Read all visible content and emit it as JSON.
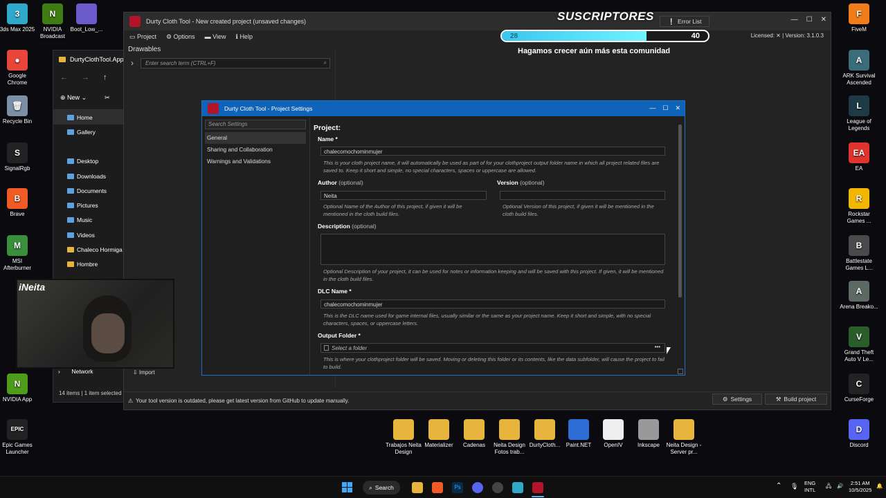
{
  "desktop": {
    "left_icons": [
      {
        "label": "3ds Max 2025",
        "icon": "3dsmax-icon",
        "color": "#2fa9c9",
        "glyph": "3"
      },
      {
        "label": "Google Chrome",
        "icon": "chrome-icon",
        "color": "#e8463a",
        "glyph": "●"
      },
      {
        "label": "Recycle Bin",
        "icon": "recycle-bin-icon",
        "color": "#7b8fa5",
        "glyph": "🗑"
      },
      {
        "label": "SignalRgb",
        "icon": "signalrgb-icon",
        "color": "#222",
        "glyph": "S"
      },
      {
        "label": "Brave",
        "icon": "brave-icon",
        "color": "#f05a24",
        "glyph": "B"
      },
      {
        "label": "MSI Afterburner",
        "icon": "msi-afterburner-icon",
        "color": "#3a8f3a",
        "glyph": "M"
      },
      {
        "label": "NVIDIA App",
        "icon": "nvidia-icon",
        "color": "#4f9b1a",
        "glyph": "N"
      },
      {
        "label": "Epic Games Launcher",
        "icon": "epic-games-icon",
        "color": "#222",
        "glyph": "EPIC"
      }
    ],
    "top_icons": [
      {
        "label": "NVIDIA Broadcast",
        "icon": "nvidia-broadcast-icon",
        "color": "#3e7d12",
        "glyph": "N"
      },
      {
        "label": "Boot_Low_...",
        "icon": "image-file-icon",
        "color": "#6b5bc8",
        "glyph": ""
      }
    ],
    "right_icons": [
      {
        "label": "FiveM",
        "icon": "fivem-icon",
        "color": "#f07d19",
        "glyph": "F"
      },
      {
        "label": "ARK Survival Ascended",
        "icon": "ark-icon",
        "color": "#3a6c7a",
        "glyph": "A"
      },
      {
        "label": "League of Legends",
        "icon": "lol-icon",
        "color": "#1d3a45",
        "glyph": "L"
      },
      {
        "label": "EA",
        "icon": "ea-icon",
        "color": "#e1342c",
        "glyph": "EA"
      },
      {
        "label": "Rockstar Games ...",
        "icon": "rockstar-icon",
        "color": "#f2b705",
        "glyph": "R"
      },
      {
        "label": "Battlestate Games L...",
        "icon": "battlestate-icon",
        "color": "#4a4a4a",
        "glyph": "B"
      },
      {
        "label": "Arena Breako...",
        "icon": "arena-breakout-icon",
        "color": "#5d6a64",
        "glyph": "A"
      },
      {
        "label": "Grand Theft Auto V Le...",
        "icon": "gta-icon",
        "color": "#2b5d2b",
        "glyph": "V"
      },
      {
        "label": "CurseForge",
        "icon": "curseforge-icon",
        "color": "#222",
        "glyph": "C"
      },
      {
        "label": "Discord",
        "icon": "discord-icon",
        "color": "#5865f2",
        "glyph": "D"
      }
    ],
    "bottom_icons": [
      {
        "label": "Trabajos Neita Design",
        "icon": "folder-icon"
      },
      {
        "label": "Materializer",
        "icon": "folder-icon"
      },
      {
        "label": "Cadenas",
        "icon": "folder-icon"
      },
      {
        "label": "Neita Design Fotos trab...",
        "icon": "folder-icon"
      },
      {
        "label": "DurtyCloth...",
        "icon": "folder-icon"
      },
      {
        "label": "Paint.NET",
        "icon": "paintnet-icon"
      },
      {
        "label": "OpenIV",
        "icon": "openiv-icon"
      },
      {
        "label": "Inkscape",
        "icon": "inkscape-icon"
      },
      {
        "label": "Neita Design - Server pr...",
        "icon": "folder-icon"
      }
    ]
  },
  "explorer": {
    "title": "DurtyClothTool.App",
    "new_label": "New",
    "nav_items": [
      {
        "label": "Home",
        "icon": "home-icon",
        "selected": true
      },
      {
        "label": "Gallery",
        "icon": "gallery-icon"
      },
      {
        "label": "Desktop",
        "icon": "desktop-icon"
      },
      {
        "label": "Downloads",
        "icon": "downloads-icon"
      },
      {
        "label": "Documents",
        "icon": "documents-icon"
      },
      {
        "label": "Pictures",
        "icon": "pictures-icon"
      },
      {
        "label": "Music",
        "icon": "music-icon"
      },
      {
        "label": "Videos",
        "icon": "videos-icon"
      },
      {
        "label": "Chaleco Hormiga",
        "icon": "folder-icon"
      },
      {
        "label": "Hombre",
        "icon": "folder-icon"
      }
    ],
    "network_label": "Network",
    "status": "14 items  |  1 item selected",
    "import_label": "Import"
  },
  "app": {
    "title": "Durty Cloth Tool - New created project (unsaved changes)",
    "menu": [
      {
        "label": "Project",
        "icon": "project-icon"
      },
      {
        "label": "Options",
        "icon": "gear-icon"
      },
      {
        "label": "View",
        "icon": "view-icon"
      },
      {
        "label": "Help",
        "icon": "info-icon"
      }
    ],
    "license": "Licensed: ✕ | Version: 3.1.0.3",
    "drawables_label": "Drawables",
    "search_placeholder": "Enter search term (CTRL+F)",
    "status_message": "Your tool version is outdated, please get latest version from GitHub to update manually.",
    "buttons": {
      "error_list": "Error List",
      "settings": "Settings",
      "build": "Build project"
    }
  },
  "overlay": {
    "title": "SUSCRIPTORES",
    "current": "28",
    "goal": "40",
    "progress": 0.7,
    "message": "Hagamos crecer aún más esta comunidad"
  },
  "dialog": {
    "title": "Durty Cloth Tool - Project Settings",
    "search_placeholder": "Search Settings",
    "nav": [
      {
        "label": "General",
        "selected": true
      },
      {
        "label": "Sharing and Collaboration"
      },
      {
        "label": "Warnings and Validations"
      }
    ],
    "section_title": "Project:",
    "name": {
      "label": "Name *",
      "value": "chalecomochominmujer",
      "hint": "This is your cloth project name, it will automatically be used as part of for your clothproject output folder name in which all project related files are saved to. Keep it short and simple, no special characters, spaces or uppercase are allowed."
    },
    "author": {
      "label": "Author",
      "optional": "(optional)",
      "value": "Neita",
      "hint": "Optional Name of the Author of this project, if given it will be mentioned in the cloth build files."
    },
    "version": {
      "label": "Version",
      "optional": "(optional)",
      "value": "",
      "hint": "Optional Version of this project, if given it will be mentioned in the cloth build files."
    },
    "description": {
      "label": "Description",
      "optional": "(optional)",
      "value": "",
      "hint": "Optional Description of your project, it can be used for notes or information keeping and will be saved with this project. If given, it will be mentioned in the cloth build files."
    },
    "dlc": {
      "label": "DLC Name *",
      "value": "chalecomochominmujer",
      "hint": "This is the DLC name used for game internal files, usually similar or the same as your project name. Keep it short and simple, with no special characters, spaces, or uppercase letters."
    },
    "output": {
      "label": "Output Folder *",
      "placeholder": "Select a folder",
      "browse": "•••",
      "hint": "This is where your clothproject folder will be saved. Moving or deleting this folder or its contents, like the data subfolder, will cause the project to fail to build."
    }
  },
  "webcam": {
    "brand": "iNeita"
  },
  "taskbar": {
    "search_label": "Search",
    "lang": "ENG",
    "region": "INTL",
    "time": "2:51 AM",
    "date": "10/5/2025"
  }
}
